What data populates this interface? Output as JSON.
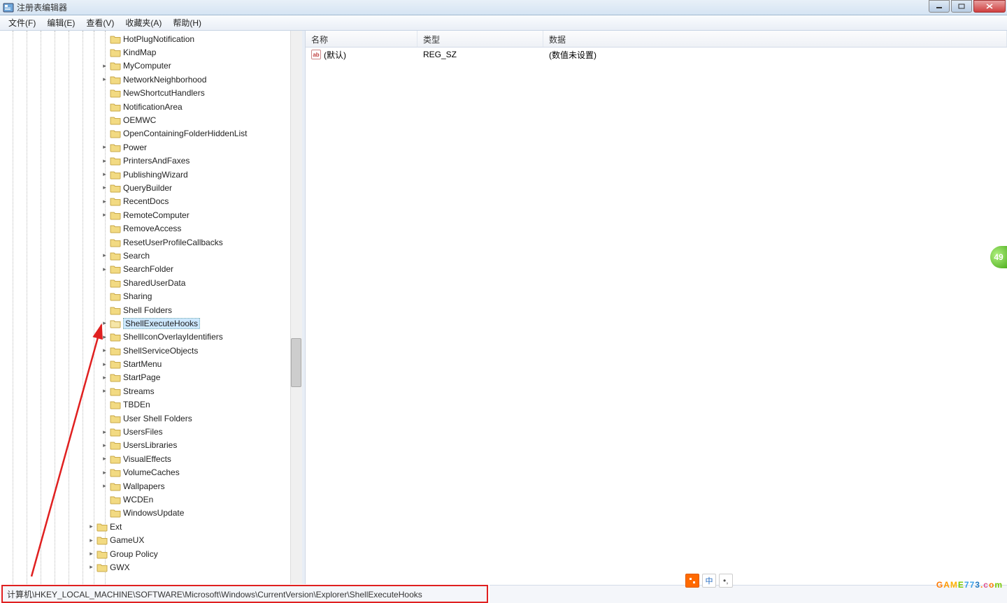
{
  "window": {
    "title": "注册表编辑器"
  },
  "menu": {
    "file": "文件(F)",
    "edit": "编辑(E)",
    "view": "查看(V)",
    "favorites": "收藏夹(A)",
    "help": "帮助(H)"
  },
  "tree": {
    "items": [
      {
        "label": "HotPlugNotification",
        "exp": false
      },
      {
        "label": "KindMap",
        "exp": false
      },
      {
        "label": "MyComputer",
        "exp": true
      },
      {
        "label": "NetworkNeighborhood",
        "exp": true
      },
      {
        "label": "NewShortcutHandlers",
        "exp": false
      },
      {
        "label": "NotificationArea",
        "exp": false
      },
      {
        "label": "OEMWC",
        "exp": false
      },
      {
        "label": "OpenContainingFolderHiddenList",
        "exp": false
      },
      {
        "label": "Power",
        "exp": true
      },
      {
        "label": "PrintersAndFaxes",
        "exp": true
      },
      {
        "label": "PublishingWizard",
        "exp": true
      },
      {
        "label": "QueryBuilder",
        "exp": true
      },
      {
        "label": "RecentDocs",
        "exp": true
      },
      {
        "label": "RemoteComputer",
        "exp": true
      },
      {
        "label": "RemoveAccess",
        "exp": false
      },
      {
        "label": "ResetUserProfileCallbacks",
        "exp": false
      },
      {
        "label": "Search",
        "exp": true
      },
      {
        "label": "SearchFolder",
        "exp": true
      },
      {
        "label": "SharedUserData",
        "exp": false
      },
      {
        "label": "Sharing",
        "exp": false
      },
      {
        "label": "Shell Folders",
        "exp": false
      },
      {
        "label": "ShellExecuteHooks",
        "exp": true,
        "selected": true
      },
      {
        "label": "ShellIconOverlayIdentifiers",
        "exp": true
      },
      {
        "label": "ShellServiceObjects",
        "exp": true
      },
      {
        "label": "StartMenu",
        "exp": true
      },
      {
        "label": "StartPage",
        "exp": true
      },
      {
        "label": "Streams",
        "exp": true
      },
      {
        "label": "TBDEn",
        "exp": false
      },
      {
        "label": "User Shell Folders",
        "exp": false
      },
      {
        "label": "UsersFiles",
        "exp": true
      },
      {
        "label": "UsersLibraries",
        "exp": true
      },
      {
        "label": "VisualEffects",
        "exp": true
      },
      {
        "label": "VolumeCaches",
        "exp": true
      },
      {
        "label": "Wallpapers",
        "exp": true
      },
      {
        "label": "WCDEn",
        "exp": false
      },
      {
        "label": "WindowsUpdate",
        "exp": false
      }
    ],
    "tail": [
      {
        "label": "Ext",
        "exp": true
      },
      {
        "label": "GameUX",
        "exp": true
      },
      {
        "label": "Group Policy",
        "exp": true
      },
      {
        "label": "GWX",
        "exp": true
      }
    ]
  },
  "list": {
    "cols": {
      "name": "名称",
      "type": "类型",
      "data": "数据"
    },
    "row0": {
      "name": "(默认)",
      "type": "REG_SZ",
      "data": "(数值未设置)"
    }
  },
  "status": {
    "path": "计算机\\HKEY_LOCAL_MACHINE\\SOFTWARE\\Microsoft\\Windows\\CurrentVersion\\Explorer\\ShellExecuteHooks"
  },
  "ime": {
    "zhong": "中"
  },
  "badge": {
    "value": "49"
  },
  "icons": {
    "string_value": "ab"
  }
}
